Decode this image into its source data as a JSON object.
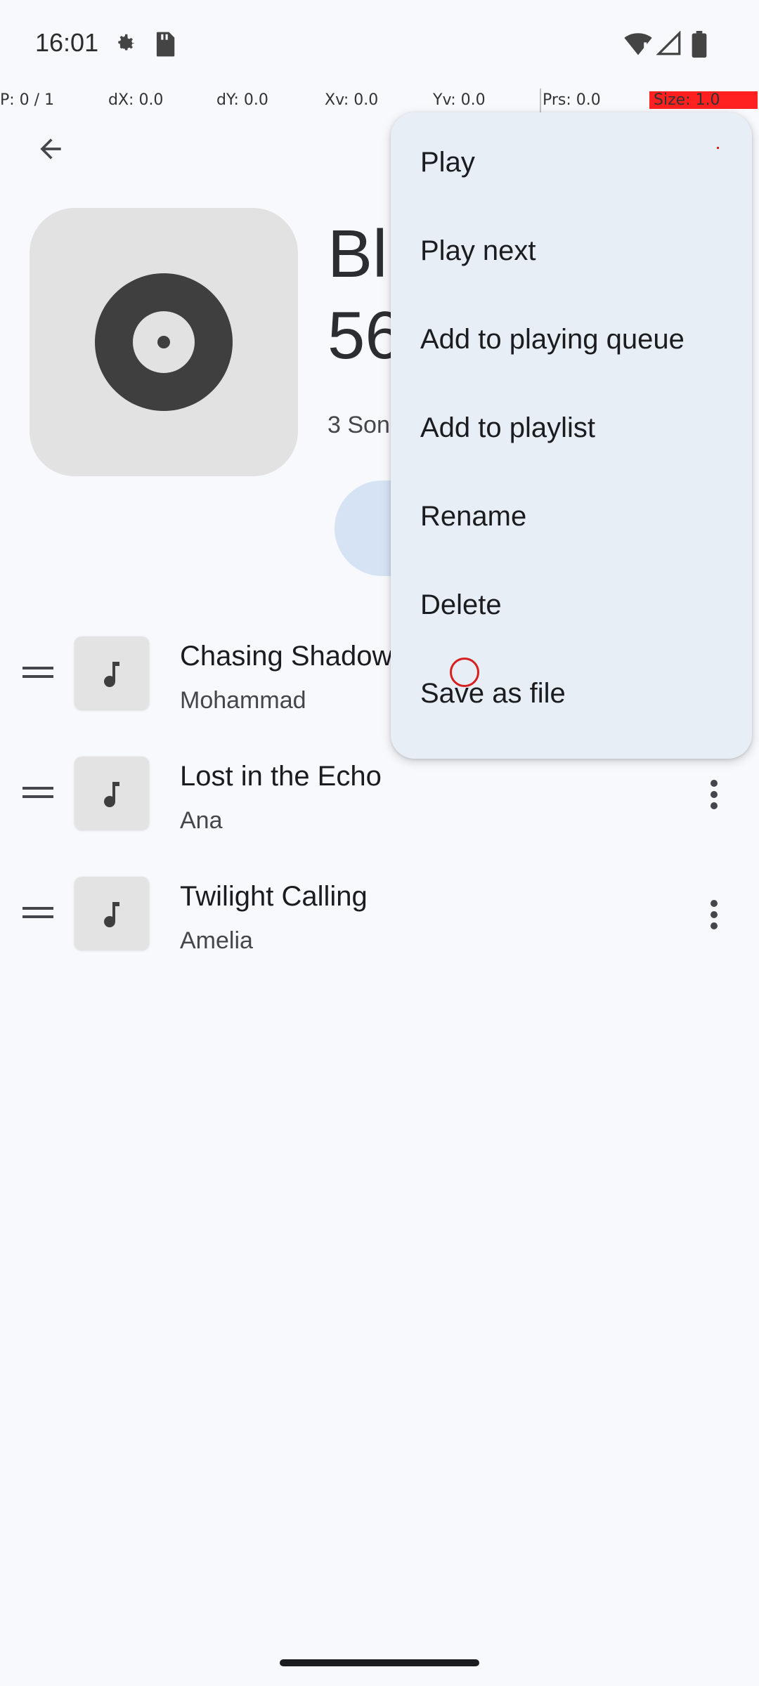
{
  "status_bar": {
    "time": "16:01"
  },
  "debug_bar": {
    "p": "P: 0 / 1",
    "dx": "dX: 0.0",
    "dy": "dY: 0.0",
    "xv": "Xv: 0.0",
    "yv": "Yv: 0.0",
    "prs": "Prs: 0.0",
    "size": "Size: 1.0"
  },
  "header": {
    "title_line1": "Bl",
    "title_line2": "56",
    "subtitle": "3 Son"
  },
  "songs": [
    {
      "title": "Chasing Shadow",
      "artist": "Mohammad"
    },
    {
      "title": "Lost in the Echo",
      "artist": "Ana"
    },
    {
      "title": "Twilight Calling",
      "artist": "Amelia"
    }
  ],
  "menu": {
    "items": [
      {
        "label": "Play"
      },
      {
        "label": "Play next"
      },
      {
        "label": "Add to playing queue"
      },
      {
        "label": "Add to playlist"
      },
      {
        "label": "Rename"
      },
      {
        "label": "Delete"
      },
      {
        "label": "Save as file"
      }
    ]
  },
  "colors": {
    "menu_bg": "#e7eef5",
    "accent_container": "#d5e3f4",
    "background": "#f8f9fc"
  }
}
